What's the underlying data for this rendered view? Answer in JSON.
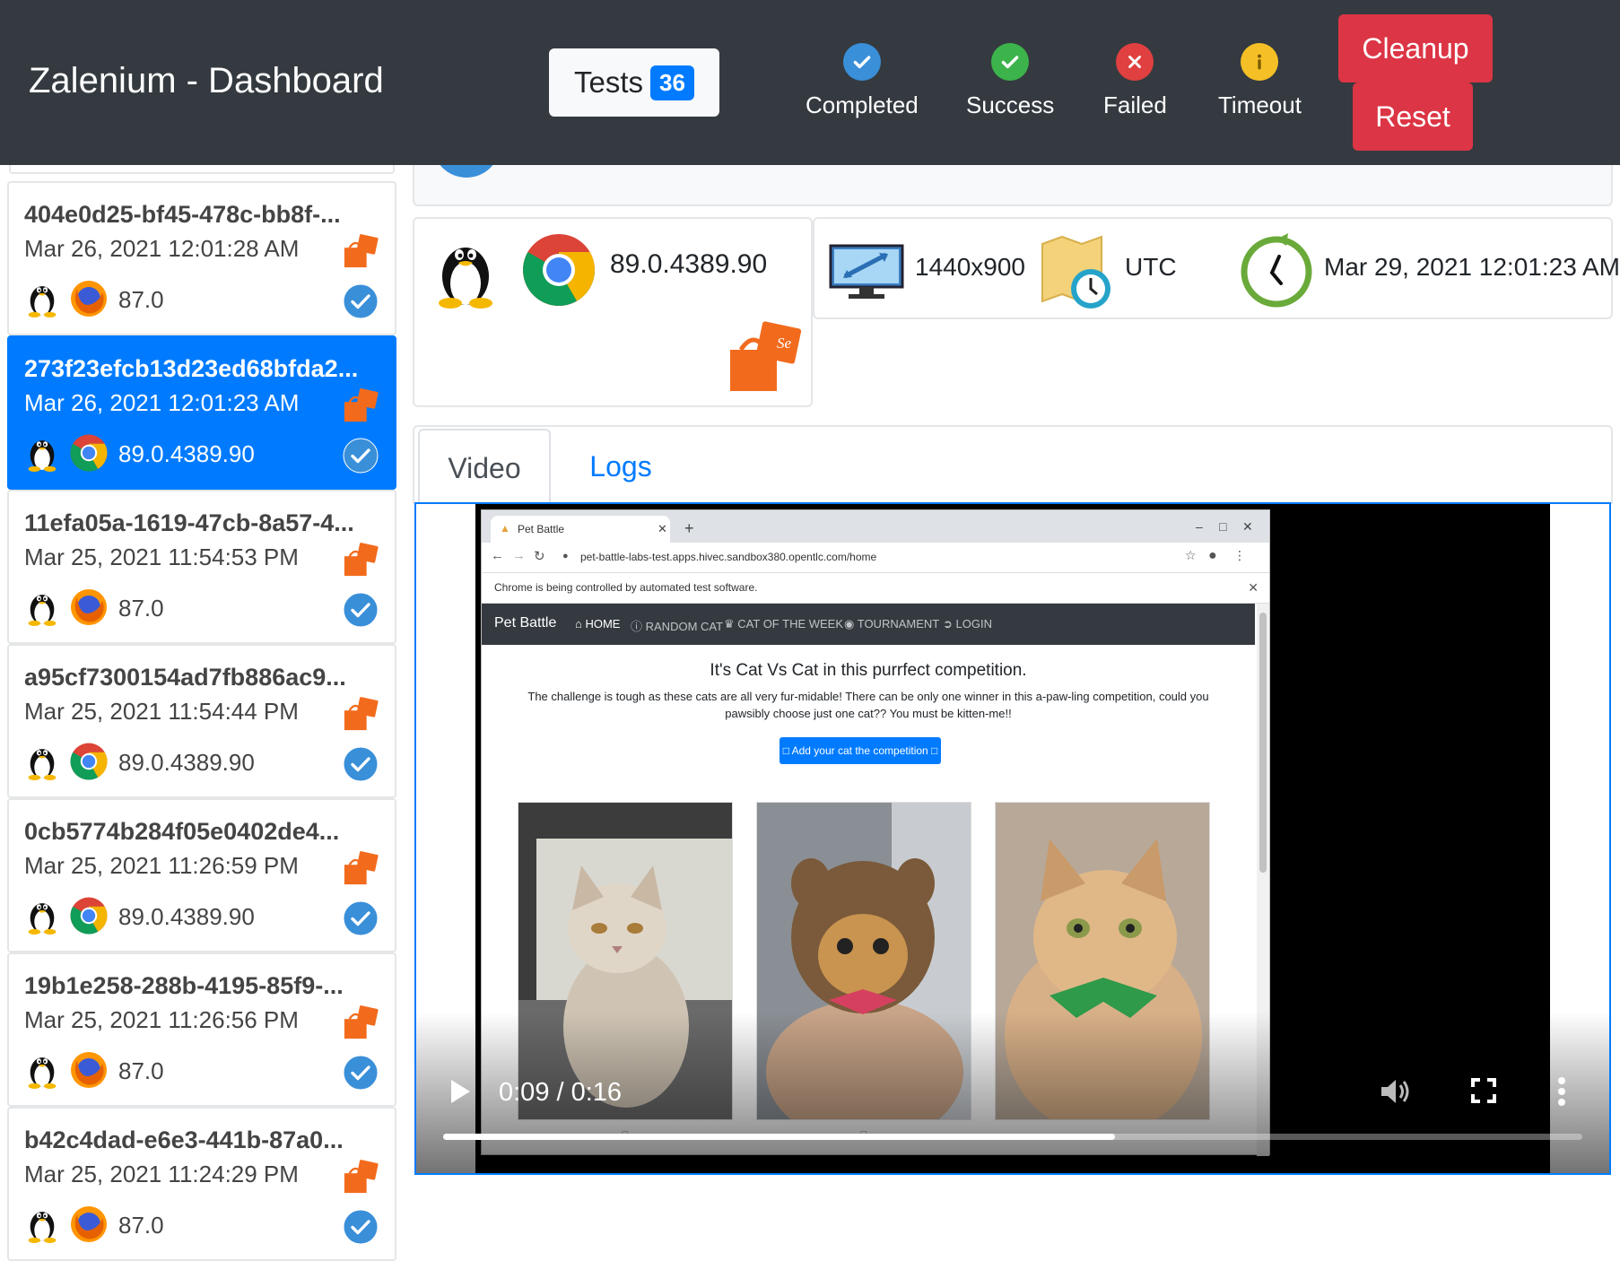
{
  "navbar": {
    "brand": "Zalenium - Dashboard",
    "tests_label": "Tests",
    "tests_count": "36",
    "stats": [
      {
        "label": "Completed",
        "icon": "check-circle-icon",
        "color": "#3a8fd9"
      },
      {
        "label": "Success",
        "icon": "check-circle-icon",
        "color": "#3cb44b"
      },
      {
        "label": "Failed",
        "icon": "x-circle-icon",
        "color": "#e04040"
      },
      {
        "label": "Timeout",
        "icon": "info-circle-icon",
        "color": "#f5c026"
      }
    ],
    "cleanup_label": "Cleanup",
    "reset_label": "Reset"
  },
  "sidebar": {
    "items": [
      {
        "title": "404e0d25-bf45-478c-bb8f-...",
        "date": "Mar 26, 2021 12:01:28 AM",
        "browser": "firefox",
        "version": "87.0",
        "active": false
      },
      {
        "title": "273f23efcb13d23ed68bfda2...",
        "date": "Mar 26, 2021 12:01:23 AM",
        "browser": "chrome",
        "version": "89.0.4389.90",
        "active": true
      },
      {
        "title": "11efa05a-1619-47cb-8a57-4...",
        "date": "Mar 25, 2021 11:54:53 PM",
        "browser": "firefox",
        "version": "87.0",
        "active": false
      },
      {
        "title": "a95cf7300154ad7fb886ac9...",
        "date": "Mar 25, 2021 11:54:44 PM",
        "browser": "chrome",
        "version": "89.0.4389.90",
        "active": false
      },
      {
        "title": "0cb5774b284f05e0402de4...",
        "date": "Mar 25, 2021 11:26:59 PM",
        "browser": "chrome",
        "version": "89.0.4389.90",
        "active": false
      },
      {
        "title": "19b1e258-288b-4195-85f9-...",
        "date": "Mar 25, 2021 11:26:56 PM",
        "browser": "firefox",
        "version": "87.0",
        "active": false
      },
      {
        "title": "b42c4dad-e6e3-441b-87a0...",
        "date": "Mar 25, 2021 11:24:29 PM",
        "browser": "firefox",
        "version": "87.0",
        "active": false
      }
    ]
  },
  "details": {
    "browser_version": "89.0.4389.90",
    "resolution": "1440x900",
    "timezone": "UTC",
    "timestamp": "Mar 29, 2021 12:01:23 AM"
  },
  "tabs": {
    "video": "Video",
    "logs": "Logs"
  },
  "video": {
    "time": "0:09 / 0:16",
    "progress": 0.59,
    "browser_tab_title": "Pet Battle",
    "url": "pet-battle-labs-test.apps.hivec.sandbox380.opentlc.com/home",
    "infobar": "Chrome is being controlled by automated test software.",
    "site": {
      "brand": "Pet Battle",
      "nav": [
        "HOME",
        "RANDOM CAT",
        "CAT OF THE WEEK",
        "TOURNAMENT",
        "LOGIN"
      ],
      "headline": "It's Cat Vs Cat in this purrfect competition.",
      "subtext": "The challenge is tough as these cats are all very fur-midable! There can be only one winner in this a-paw-ling competition, could you pawsibly choose just one cat?? You must be kitten-me!!",
      "button": "□ Add your cat the competition □",
      "captions": [
        "□",
        "□",
        ""
      ]
    }
  },
  "colors": {
    "navbar": "#343a40",
    "accent": "#007bff",
    "danger": "#dc3545"
  }
}
